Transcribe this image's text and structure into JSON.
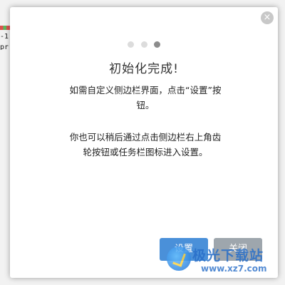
{
  "dialog": {
    "title": "初始化完成!",
    "paragraph1": "如需自定义侧边栏界面，点击“设置”按钮。",
    "paragraph2": "你也可以稍后通过点击侧边栏右上角齿轮按钮或任务栏图标进入设置。",
    "close_glyph": "×",
    "page_indicator": {
      "total": 3,
      "active": 3
    },
    "buttons": {
      "primary": "设置",
      "secondary": "关闭"
    }
  },
  "background": {
    "partial_text": "-1 pr"
  },
  "watermark": {
    "brand": "极光下载站",
    "url": "www.xz7.com"
  },
  "colors": {
    "primary": "#4a90d9",
    "secondary": "#9ea6ad",
    "close": "#c8c8c8"
  }
}
